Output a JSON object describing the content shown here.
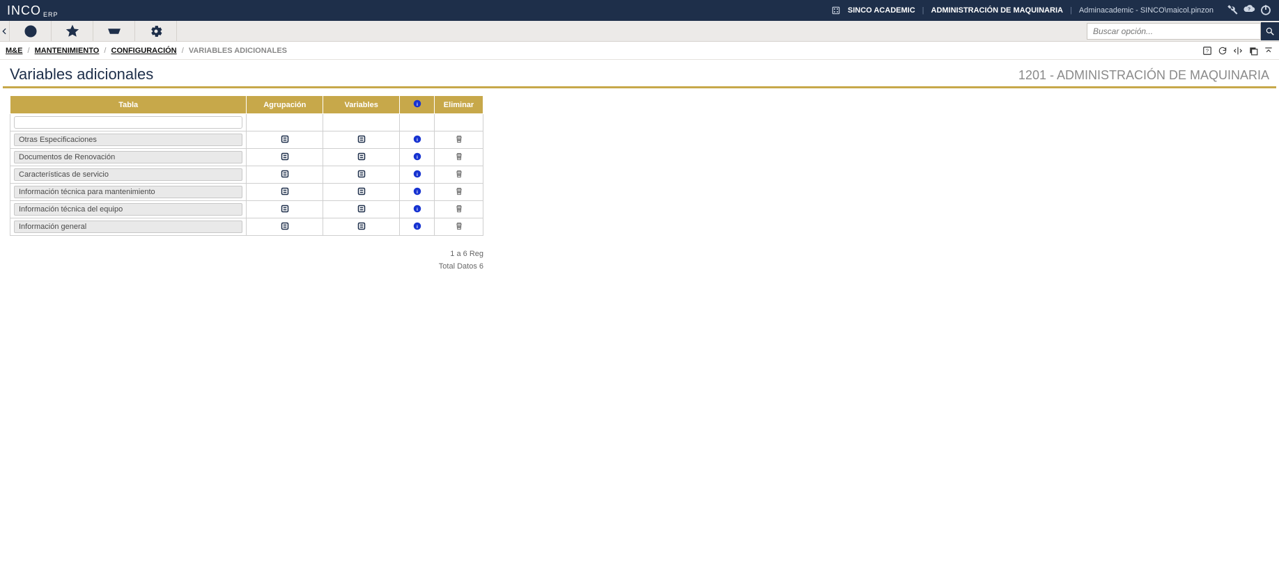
{
  "brand": {
    "name": "INCO",
    "sub": "ERP"
  },
  "topbar": {
    "academic": "SINCO ACADEMIC",
    "module": "ADMINISTRACIÓN DE MAQUINARIA",
    "user": "Adminacademic - SINCO\\maicol.pinzon"
  },
  "search": {
    "placeholder": "Buscar opción..."
  },
  "breadcrumb": {
    "items": [
      "M&E",
      "MANTENIMIENTO",
      "CONFIGURACIÓN"
    ],
    "current": "VARIABLES ADICIONALES"
  },
  "page": {
    "title": "Variables adicionales",
    "subtitle": "1201 - ADMINISTRACIÓN DE MAQUINARIA"
  },
  "table": {
    "headers": {
      "tabla": "Tabla",
      "agrupacion": "Agrupación",
      "variables": "Variables",
      "eliminar": "Eliminar"
    },
    "rows": [
      {
        "tabla": "Otras Especificaciones"
      },
      {
        "tabla": "Documentos de Renovación"
      },
      {
        "tabla": "Características de servicio"
      },
      {
        "tabla": "Información técnica para mantenimiento"
      },
      {
        "tabla": "Información técnica del equipo"
      },
      {
        "tabla": "Información general"
      }
    ]
  },
  "pager": {
    "range": "1 a 6 Reg",
    "total": "Total Datos 6"
  }
}
